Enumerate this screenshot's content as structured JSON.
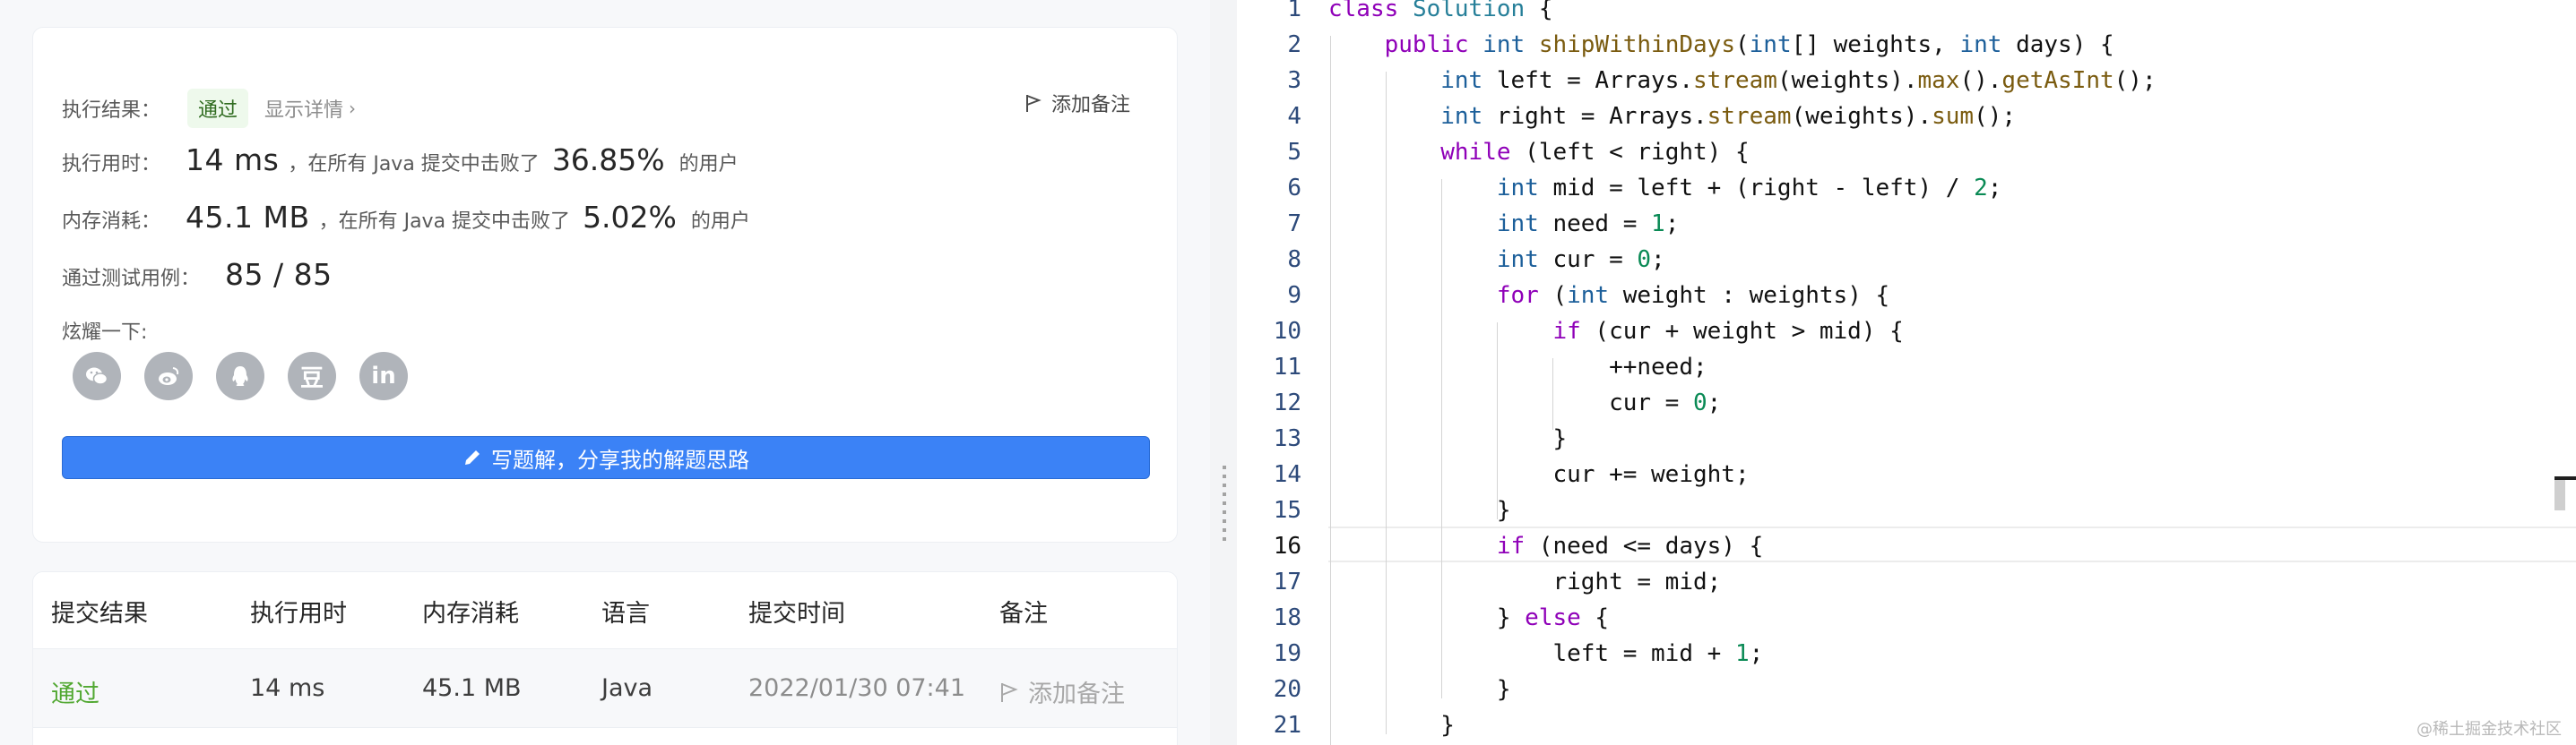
{
  "result": {
    "label": "执行结果：",
    "status": "通过",
    "details": "显示详情",
    "add_note": "添加备注",
    "runtime_label": "执行用时：",
    "runtime_value": "14 ms",
    "runtime_text": "，在所有 Java 提交中击败了",
    "runtime_pct": "36.85%",
    "users_text": "的用户",
    "memory_label": "内存消耗：",
    "memory_value": "45.1 MB",
    "memory_text": "，在所有 Java 提交中击败了",
    "memory_pct": "5.02%",
    "tests_label": "通过测试用例：",
    "tests_value": "85 / 85",
    "share_label": "炫耀一下:",
    "share_icons": [
      "wechat-icon",
      "weibo-icon",
      "qq-icon",
      "douban-icon",
      "linkedin-icon"
    ],
    "douban_glyph": "豆",
    "linkedin_glyph": "in",
    "write_button": "写题解，分享我的解题思路"
  },
  "table": {
    "headers": [
      "提交结果",
      "执行用时",
      "内存消耗",
      "语言",
      "提交时间",
      "备注"
    ],
    "row": {
      "result": "通过",
      "runtime": "14 ms",
      "memory": "45.1 MB",
      "language": "Java",
      "time": "2022/01/30 07:41",
      "note": "添加备注"
    }
  },
  "editor": {
    "line_numbers": [
      "1",
      "2",
      "3",
      "4",
      "5",
      "6",
      "7",
      "8",
      "9",
      "10",
      "11",
      "12",
      "13",
      "14",
      "15",
      "16",
      "17",
      "18",
      "19",
      "20",
      "21"
    ],
    "active_line": "16"
  },
  "watermark": "@稀土掘金技术社区",
  "colors": {
    "accent": "#3b82f6",
    "pass": "#52a832",
    "keyword": "#8f00b8",
    "type": "#1c5f9a",
    "number": "#0a8a55"
  }
}
